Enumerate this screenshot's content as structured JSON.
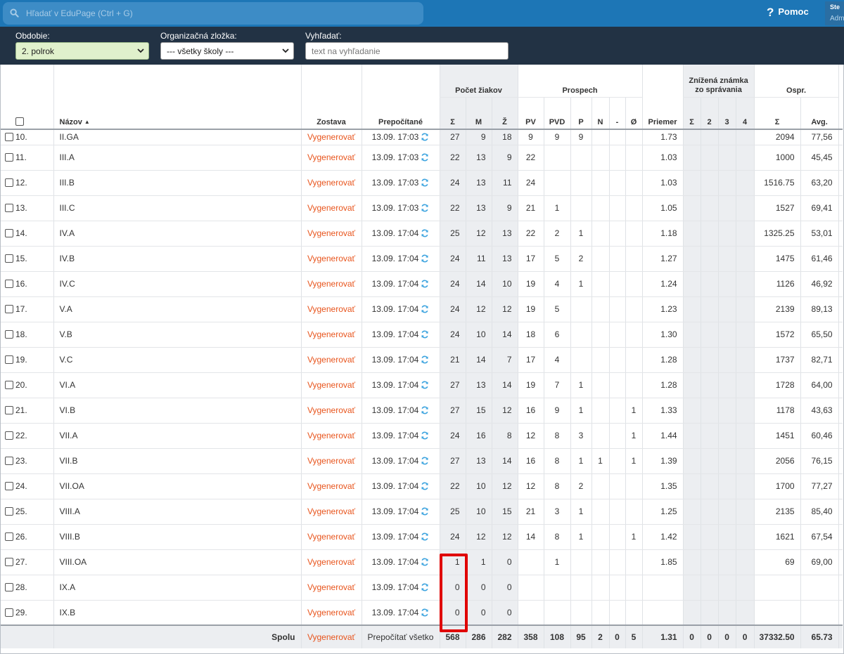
{
  "search": {
    "placeholder": "Hľadať v EduPage (Ctrl + G)"
  },
  "help": {
    "label": "Pomoc"
  },
  "user": {
    "name": "Ste",
    "role": "Adm"
  },
  "filters": {
    "period_label": "Obdobie:",
    "period_value": "2. polrok",
    "org_label": "Organizačná zložka:",
    "org_value": "--- všetky školy ---",
    "search_label": "Vyhľadať:",
    "search_placeholder": "text na vyhľadanie"
  },
  "headers": {
    "pocet_ziakov": "Počet žiakov",
    "prospech": "Prospech",
    "znizena": "Znížená známka zo správania",
    "ospr": "Ospr.",
    "nazov": "Názov",
    "zostava": "Zostava",
    "prepocitane": "Prepočítané",
    "sum": "Σ",
    "m": "M",
    "z": "Ž",
    "pv": "PV",
    "pvd": "PVD",
    "p": "P",
    "n": "N",
    "dash": "-",
    "o": "Ø",
    "priemer": "Priemer",
    "zn_sum": "Σ",
    "zn2": "2",
    "zn3": "3",
    "zn4": "4",
    "os_sum": "Σ",
    "os_avg": "Avg."
  },
  "colors": {
    "accent": "#e8541c",
    "topbar": "#1d76b6",
    "filterbar": "#223244",
    "highlight": "#e00000"
  },
  "rows": [
    {
      "num": "10.",
      "name": "II.GA",
      "gen": "Vygenerovať",
      "recalc": "13.09. 17:03",
      "sum": "27",
      "m": "9",
      "z": "18",
      "pv": "9",
      "pvd": "9",
      "p": "9",
      "n": "",
      "d": "",
      "o": "",
      "avg": "1.73",
      "os": "2094",
      "osa": "77,56"
    },
    {
      "num": "11.",
      "name": "III.A",
      "gen": "Vygenerovať",
      "recalc": "13.09. 17:03",
      "sum": "22",
      "m": "13",
      "z": "9",
      "pv": "22",
      "pvd": "",
      "p": "",
      "n": "",
      "d": "",
      "o": "",
      "avg": "1.03",
      "os": "1000",
      "osa": "45,45"
    },
    {
      "num": "12.",
      "name": "III.B",
      "gen": "Vygenerovať",
      "recalc": "13.09. 17:03",
      "sum": "24",
      "m": "13",
      "z": "11",
      "pv": "24",
      "pvd": "",
      "p": "",
      "n": "",
      "d": "",
      "o": "",
      "avg": "1.03",
      "os": "1516.75",
      "osa": "63,20"
    },
    {
      "num": "13.",
      "name": "III.C",
      "gen": "Vygenerovať",
      "recalc": "13.09. 17:03",
      "sum": "22",
      "m": "13",
      "z": "9",
      "pv": "21",
      "pvd": "1",
      "p": "",
      "n": "",
      "d": "",
      "o": "",
      "avg": "1.05",
      "os": "1527",
      "osa": "69,41"
    },
    {
      "num": "14.",
      "name": "IV.A",
      "gen": "Vygenerovať",
      "recalc": "13.09. 17:04",
      "sum": "25",
      "m": "12",
      "z": "13",
      "pv": "22",
      "pvd": "2",
      "p": "1",
      "n": "",
      "d": "",
      "o": "",
      "avg": "1.18",
      "os": "1325.25",
      "osa": "53,01"
    },
    {
      "num": "15.",
      "name": "IV.B",
      "gen": "Vygenerovať",
      "recalc": "13.09. 17:04",
      "sum": "24",
      "m": "11",
      "z": "13",
      "pv": "17",
      "pvd": "5",
      "p": "2",
      "n": "",
      "d": "",
      "o": "",
      "avg": "1.27",
      "os": "1475",
      "osa": "61,46"
    },
    {
      "num": "16.",
      "name": "IV.C",
      "gen": "Vygenerovať",
      "recalc": "13.09. 17:04",
      "sum": "24",
      "m": "14",
      "z": "10",
      "pv": "19",
      "pvd": "4",
      "p": "1",
      "n": "",
      "d": "",
      "o": "",
      "avg": "1.24",
      "os": "1126",
      "osa": "46,92"
    },
    {
      "num": "17.",
      "name": "V.A",
      "gen": "Vygenerovať",
      "recalc": "13.09. 17:04",
      "sum": "24",
      "m": "12",
      "z": "12",
      "pv": "19",
      "pvd": "5",
      "p": "",
      "n": "",
      "d": "",
      "o": "",
      "avg": "1.23",
      "os": "2139",
      "osa": "89,13"
    },
    {
      "num": "18.",
      "name": "V.B",
      "gen": "Vygenerovať",
      "recalc": "13.09. 17:04",
      "sum": "24",
      "m": "10",
      "z": "14",
      "pv": "18",
      "pvd": "6",
      "p": "",
      "n": "",
      "d": "",
      "o": "",
      "avg": "1.30",
      "os": "1572",
      "osa": "65,50"
    },
    {
      "num": "19.",
      "name": "V.C",
      "gen": "Vygenerovať",
      "recalc": "13.09. 17:04",
      "sum": "21",
      "m": "14",
      "z": "7",
      "pv": "17",
      "pvd": "4",
      "p": "",
      "n": "",
      "d": "",
      "o": "",
      "avg": "1.28",
      "os": "1737",
      "osa": "82,71"
    },
    {
      "num": "20.",
      "name": "VI.A",
      "gen": "Vygenerovať",
      "recalc": "13.09. 17:04",
      "sum": "27",
      "m": "13",
      "z": "14",
      "pv": "19",
      "pvd": "7",
      "p": "1",
      "n": "",
      "d": "",
      "o": "",
      "avg": "1.28",
      "os": "1728",
      "osa": "64,00"
    },
    {
      "num": "21.",
      "name": "VI.B",
      "gen": "Vygenerovať",
      "recalc": "13.09. 17:04",
      "sum": "27",
      "m": "15",
      "z": "12",
      "pv": "16",
      "pvd": "9",
      "p": "1",
      "n": "",
      "d": "",
      "o": "1",
      "avg": "1.33",
      "os": "1178",
      "osa": "43,63"
    },
    {
      "num": "22.",
      "name": "VII.A",
      "gen": "Vygenerovať",
      "recalc": "13.09. 17:04",
      "sum": "24",
      "m": "16",
      "z": "8",
      "pv": "12",
      "pvd": "8",
      "p": "3",
      "n": "",
      "d": "",
      "o": "1",
      "avg": "1.44",
      "os": "1451",
      "osa": "60,46"
    },
    {
      "num": "23.",
      "name": "VII.B",
      "gen": "Vygenerovať",
      "recalc": "13.09. 17:04",
      "sum": "27",
      "m": "13",
      "z": "14",
      "pv": "16",
      "pvd": "8",
      "p": "1",
      "n": "1",
      "d": "",
      "o": "1",
      "avg": "1.39",
      "os": "2056",
      "osa": "76,15"
    },
    {
      "num": "24.",
      "name": "VII.OA",
      "gen": "Vygenerovať",
      "recalc": "13.09. 17:04",
      "sum": "22",
      "m": "10",
      "z": "12",
      "pv": "12",
      "pvd": "8",
      "p": "2",
      "n": "",
      "d": "",
      "o": "",
      "avg": "1.35",
      "os": "1700",
      "osa": "77,27"
    },
    {
      "num": "25.",
      "name": "VIII.A",
      "gen": "Vygenerovať",
      "recalc": "13.09. 17:04",
      "sum": "25",
      "m": "10",
      "z": "15",
      "pv": "21",
      "pvd": "3",
      "p": "1",
      "n": "",
      "d": "",
      "o": "",
      "avg": "1.25",
      "os": "2135",
      "osa": "85,40"
    },
    {
      "num": "26.",
      "name": "VIII.B",
      "gen": "Vygenerovať",
      "recalc": "13.09. 17:04",
      "sum": "24",
      "m": "12",
      "z": "12",
      "pv": "14",
      "pvd": "8",
      "p": "1",
      "n": "",
      "d": "",
      "o": "1",
      "avg": "1.42",
      "os": "1621",
      "osa": "67,54"
    },
    {
      "num": "27.",
      "name": "VIII.OA",
      "gen": "Vygenerovať",
      "recalc": "13.09. 17:04",
      "sum": "1",
      "m": "1",
      "z": "0",
      "pv": "",
      "pvd": "1",
      "p": "",
      "n": "",
      "d": "",
      "o": "",
      "avg": "1.85",
      "os": "69",
      "osa": "69,00"
    },
    {
      "num": "28.",
      "name": "IX.A",
      "gen": "Vygenerovať",
      "recalc": "13.09. 17:04",
      "sum": "0",
      "m": "0",
      "z": "0",
      "pv": "",
      "pvd": "",
      "p": "",
      "n": "",
      "d": "",
      "o": "",
      "avg": "",
      "os": "",
      "osa": ""
    },
    {
      "num": "29.",
      "name": "IX.B",
      "gen": "Vygenerovať",
      "recalc": "13.09. 17:04",
      "sum": "0",
      "m": "0",
      "z": "0",
      "pv": "",
      "pvd": "",
      "p": "",
      "n": "",
      "d": "",
      "o": "",
      "avg": "",
      "os": "",
      "osa": ""
    }
  ],
  "footer": {
    "label": "Spolu",
    "gen": "Vygenerovať",
    "recalc_all": "Prepočítať všetko",
    "sum": "568",
    "m": "286",
    "z": "282",
    "pv": "358",
    "pvd": "108",
    "p": "95",
    "n": "2",
    "d": "0",
    "o": "5",
    "avg": "1.31",
    "zn_sum": "0",
    "zn2": "0",
    "zn3": "0",
    "zn4": "0",
    "os": "37332.50",
    "osa": "65.73"
  }
}
